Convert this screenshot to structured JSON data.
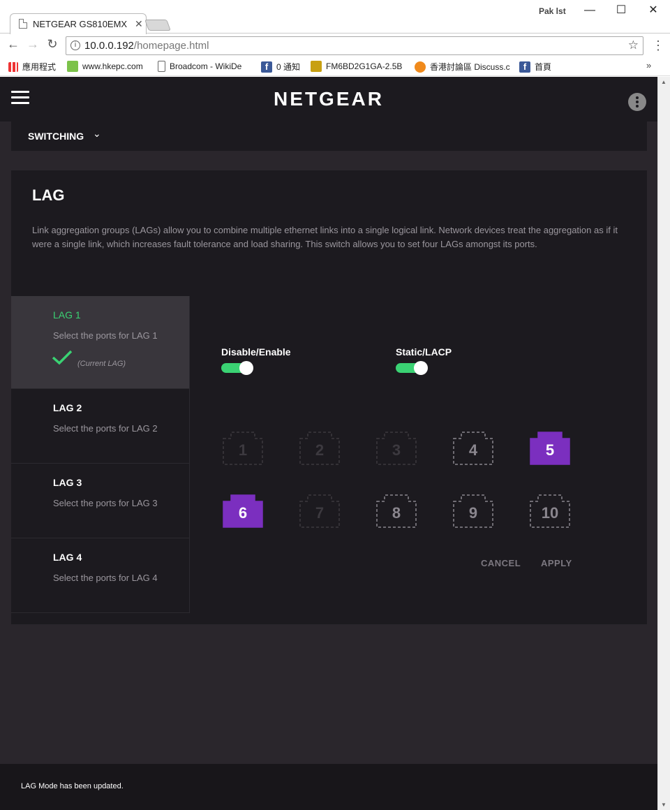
{
  "browser": {
    "tab_title": "NETGEAR GS810EMX",
    "window_user": "Pak lst",
    "url_host": "10.0.0.192",
    "url_path": "/homepage.html",
    "bookmarks": [
      {
        "label": "應用程式",
        "icon": "apps-icon"
      },
      {
        "label": "www.hkepc.com",
        "icon": "site-icon"
      },
      {
        "label": "Broadcom - WikiDe",
        "icon": "page-icon"
      },
      {
        "label": "0 通知",
        "icon": "facebook-icon"
      },
      {
        "label": "FM6BD2G1GA-2.5B",
        "icon": "image-icon"
      },
      {
        "label": "香港討論區 Discuss.c",
        "icon": "chat-icon"
      },
      {
        "label": "首頁",
        "icon": "facebook-icon"
      }
    ],
    "bookmarks_more": "»"
  },
  "app": {
    "brand": "NETGEAR",
    "subnav": "SWITCHING"
  },
  "lag": {
    "title": "LAG",
    "description": "Link aggregation groups (LAGs) allow you to combine multiple ethernet links into a single logical link. Network devices treat the aggregation as if it were a single link, which increases fault tolerance and load sharing. This switch allows you to set four LAGs amongst its ports.",
    "items": [
      {
        "name": "LAG 1",
        "subtitle": "Select the ports for LAG 1",
        "current_label": "(Current LAG)"
      },
      {
        "name": "LAG 2",
        "subtitle": "Select the ports for LAG 2"
      },
      {
        "name": "LAG 3",
        "subtitle": "Select the ports for LAG 3"
      },
      {
        "name": "LAG 4",
        "subtitle": "Select the ports for LAG 4"
      }
    ],
    "toggles": [
      {
        "label": "Disable/Enable",
        "on": true
      },
      {
        "label": "Static/LACP",
        "on": true
      }
    ],
    "ports": [
      {
        "num": "1",
        "state": "disabled"
      },
      {
        "num": "2",
        "state": "disabled"
      },
      {
        "num": "3",
        "state": "disabled"
      },
      {
        "num": "4",
        "state": "available"
      },
      {
        "num": "5",
        "state": "selected"
      },
      {
        "num": "6",
        "state": "selected"
      },
      {
        "num": "7",
        "state": "disabled"
      },
      {
        "num": "8",
        "state": "available"
      },
      {
        "num": "9",
        "state": "available"
      },
      {
        "num": "10",
        "state": "available"
      }
    ],
    "cancel_label": "CANCEL",
    "apply_label": "APPLY"
  },
  "footer": {
    "message": "LAG Mode has been updated."
  },
  "colors": {
    "accent_green": "#3ad273",
    "port_selected": "#7b2fbf",
    "background": "#2a262c",
    "panel": "#1c1a1f"
  }
}
